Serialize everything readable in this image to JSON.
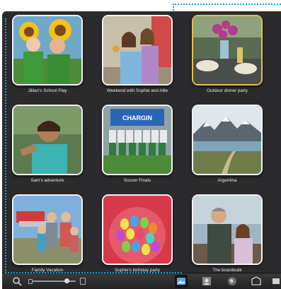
{
  "events": [
    {
      "title": "Jillian's School Play",
      "selected": false
    },
    {
      "title": "Weekend with Sophie and Allie",
      "selected": false
    },
    {
      "title": "Outdoor dinner party",
      "selected": true
    },
    {
      "title": "Sam's adventure",
      "selected": false
    },
    {
      "title": "Soccer Finals",
      "selected": false
    },
    {
      "title": "Argentina",
      "selected": false
    },
    {
      "title": "Family Vacation",
      "selected": false
    },
    {
      "title": "Sophie's birthday party",
      "selected": false
    },
    {
      "title": "The boardwalk",
      "selected": false
    }
  ],
  "toolbar": {
    "search_icon": "search-icon",
    "zoom": 0.8,
    "views": [
      "events-view-icon",
      "faces-icon",
      "places-icon",
      "projects-icon",
      "more-icon"
    ],
    "active_view": "events-view-icon"
  },
  "colors": {
    "background": "#2b2b2d",
    "selection": "#e3bf4e",
    "focus_dots": "#1a9fd0"
  }
}
